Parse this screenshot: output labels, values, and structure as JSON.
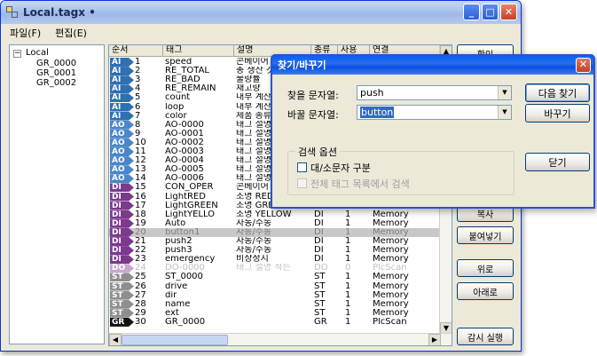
{
  "window": {
    "title": "Local.tagx •"
  },
  "menu": [
    "파일(F)",
    "편집(E)"
  ],
  "tree": {
    "root": "Local",
    "children": [
      "GR_0000",
      "GR_0001",
      "GR_0002"
    ]
  },
  "columns": [
    "순서",
    "태그",
    "설명",
    "종류",
    "사용",
    "연결"
  ],
  "rows": [
    {
      "type": "AI",
      "num": "1",
      "tag": "speed",
      "desc": "콘베이어 속",
      "kind": "",
      "use": "",
      "conn": ""
    },
    {
      "type": "AI",
      "num": "2",
      "tag": "RE_TOTAL",
      "desc": "총 생산 갯",
      "kind": "",
      "use": "",
      "conn": ""
    },
    {
      "type": "AI",
      "num": "3",
      "tag": "RE_BAD",
      "desc": "불량률",
      "kind": "",
      "use": "",
      "conn": ""
    },
    {
      "type": "AI",
      "num": "4",
      "tag": "RE_REMAIN",
      "desc": "재고량",
      "kind": "",
      "use": "",
      "conn": ""
    },
    {
      "type": "AI",
      "num": "5",
      "tag": "count",
      "desc": "내부 계산",
      "kind": "",
      "use": "",
      "conn": ""
    },
    {
      "type": "AI",
      "num": "6",
      "tag": "loop",
      "desc": "내부 계산",
      "kind": "",
      "use": "",
      "conn": ""
    },
    {
      "type": "AI",
      "num": "7",
      "tag": "color",
      "desc": "제품 종류",
      "kind": "",
      "use": "",
      "conn": ""
    },
    {
      "type": "AO",
      "num": "8",
      "tag": "AO-0000",
      "desc": "태그 설명",
      "kind": "",
      "use": "",
      "conn": ""
    },
    {
      "type": "AO",
      "num": "9",
      "tag": "AO-0001",
      "desc": "태그 설명",
      "kind": "",
      "use": "",
      "conn": ""
    },
    {
      "type": "AO",
      "num": "10",
      "tag": "AO-0002",
      "desc": "태그 설명",
      "kind": "",
      "use": "",
      "conn": ""
    },
    {
      "type": "AO",
      "num": "11",
      "tag": "AO-0003",
      "desc": "태그 설명",
      "kind": "",
      "use": "",
      "conn": ""
    },
    {
      "type": "AO",
      "num": "12",
      "tag": "AO-0004",
      "desc": "태그 설명",
      "kind": "",
      "use": "",
      "conn": ""
    },
    {
      "type": "AO",
      "num": "13",
      "tag": "AO-0005",
      "desc": "태그 설명",
      "kind": "",
      "use": "",
      "conn": ""
    },
    {
      "type": "AO",
      "num": "14",
      "tag": "AO-0006",
      "desc": "태그 설명",
      "kind": "",
      "use": "",
      "conn": ""
    },
    {
      "type": "DI",
      "num": "15",
      "tag": "CON_OPER",
      "desc": "콘베이어 동",
      "kind": "",
      "use": "",
      "conn": ""
    },
    {
      "type": "DI",
      "num": "16",
      "tag": "LightRED",
      "desc": "조명 RED",
      "kind": "",
      "use": "",
      "conn": ""
    },
    {
      "type": "DI",
      "num": "17",
      "tag": "LightGREEN",
      "desc": "조명 GREEN",
      "kind": "",
      "use": "",
      "conn": ""
    },
    {
      "type": "DI",
      "num": "18",
      "tag": "LightYELLO",
      "desc": "조명 YELLOW",
      "kind": "DI",
      "use": "1",
      "conn": "Memory"
    },
    {
      "type": "DI",
      "num": "19",
      "tag": "Auto",
      "desc": "자동/수동",
      "kind": "DI",
      "use": "1",
      "conn": "Memory"
    },
    {
      "type": "DI",
      "num": "20",
      "tag": "button1",
      "desc": "자동/수동",
      "kind": "DI",
      "use": "1",
      "conn": "Memory",
      "selected": true
    },
    {
      "type": "DI",
      "num": "21",
      "tag": "push2",
      "desc": "자동/수동",
      "kind": "DI",
      "use": "1",
      "conn": "Memory"
    },
    {
      "type": "DI",
      "num": "22",
      "tag": "push3",
      "desc": "자동/수동",
      "kind": "DI",
      "use": "1",
      "conn": "Memory"
    },
    {
      "type": "DI",
      "num": "23",
      "tag": "emergency",
      "desc": "비상정지",
      "kind": "DI",
      "use": "1",
      "conn": "Memory"
    },
    {
      "type": "DO",
      "num": "24",
      "tag": "DO-0000",
      "desc": "태그 설명 적는",
      "kind": "DO",
      "use": "0",
      "conn": "PlcScan",
      "disabled": true
    },
    {
      "type": "ST",
      "num": "25",
      "tag": "ST_0000",
      "desc": "",
      "kind": "ST",
      "use": "1",
      "conn": "Memory"
    },
    {
      "type": "ST",
      "num": "26",
      "tag": "drive",
      "desc": "",
      "kind": "ST",
      "use": "1",
      "conn": "Memory"
    },
    {
      "type": "ST",
      "num": "27",
      "tag": "dir",
      "desc": "",
      "kind": "ST",
      "use": "1",
      "conn": "Memory"
    },
    {
      "type": "ST",
      "num": "28",
      "tag": "name",
      "desc": "",
      "kind": "ST",
      "use": "1",
      "conn": "Memory"
    },
    {
      "type": "ST",
      "num": "29",
      "tag": "ext",
      "desc": "",
      "kind": "ST",
      "use": "1",
      "conn": "Memory"
    },
    {
      "type": "GR",
      "num": "30",
      "tag": "GR_0000",
      "desc": "",
      "kind": "GR",
      "use": "1",
      "conn": "PlcScan"
    }
  ],
  "badge_colors": {
    "AI": "#2f6fb3",
    "AO": "#4a86c8",
    "DI": "#7b3a8c",
    "DO": "#c7a8cf",
    "ST": "#8e8e8e",
    "GR": "#111111"
  },
  "side_buttons": [
    "확인",
    "복사",
    "붙여넣기",
    "위로",
    "아래로",
    "감시 실행"
  ],
  "dialog": {
    "title": "찾기/바꾸기",
    "find_label": "찾을 문자열:",
    "find_value": "push",
    "replace_label": "바꿀 문자열:",
    "replace_value": "button",
    "btn_find_next": "다음 찾기",
    "btn_replace": "바꾸기",
    "btn_close": "닫기",
    "group_title": "검색 옵션",
    "opt_case": "대/소문자 구분",
    "opt_all": "전체 태그 목록에서 검색"
  }
}
